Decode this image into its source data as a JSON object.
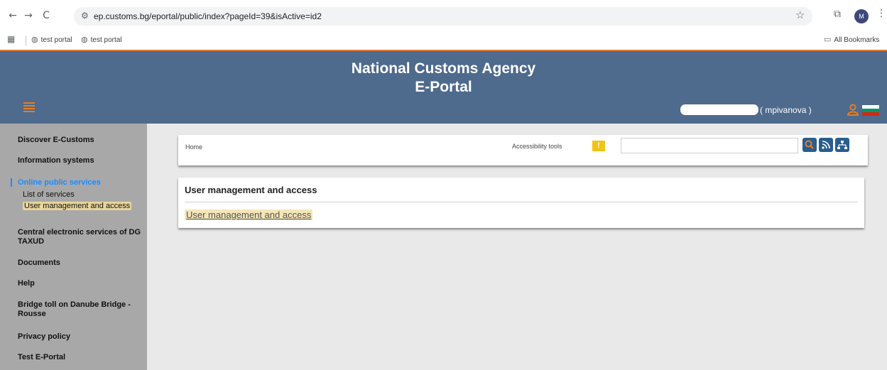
{
  "browser": {
    "nav": {
      "back": "←",
      "forward": "→",
      "reload": "C"
    },
    "url": "ep.customs.bg/eportal/public/index?pageId=39&isActive=id2",
    "profile_initial": "M",
    "bookmarks": [
      {
        "label": "test portal"
      },
      {
        "label": "test portal"
      }
    ],
    "all_bookmarks_label": "All Bookmarks"
  },
  "header": {
    "title_line1": "National Customs Agency",
    "title_line2": "E-Portal",
    "username": "( mpivanova )",
    "accent_color": "#e67e22",
    "bg_color": "#4e6a8d"
  },
  "sidebar": {
    "items": [
      {
        "label": "Discover E-Customs"
      },
      {
        "label": "Information systems"
      },
      {
        "label": "Online public services",
        "active": true
      },
      {
        "label": "List of services"
      },
      {
        "label": "User management and access"
      },
      {
        "label": "Central electronic services of DG TAXUD"
      },
      {
        "label": "Documents"
      },
      {
        "label": "Help"
      },
      {
        "label": "Bridge toll on Danube Bridge - Rousse"
      },
      {
        "label": "Privacy policy"
      },
      {
        "label": "Test E-Portal"
      }
    ]
  },
  "toolbar": {
    "breadcrumb": "Home",
    "accessibility_label": "Accessibility tools",
    "alert_glyph": "!",
    "search_placeholder": ""
  },
  "panel": {
    "title": "User management and access",
    "link": "User management and access"
  }
}
